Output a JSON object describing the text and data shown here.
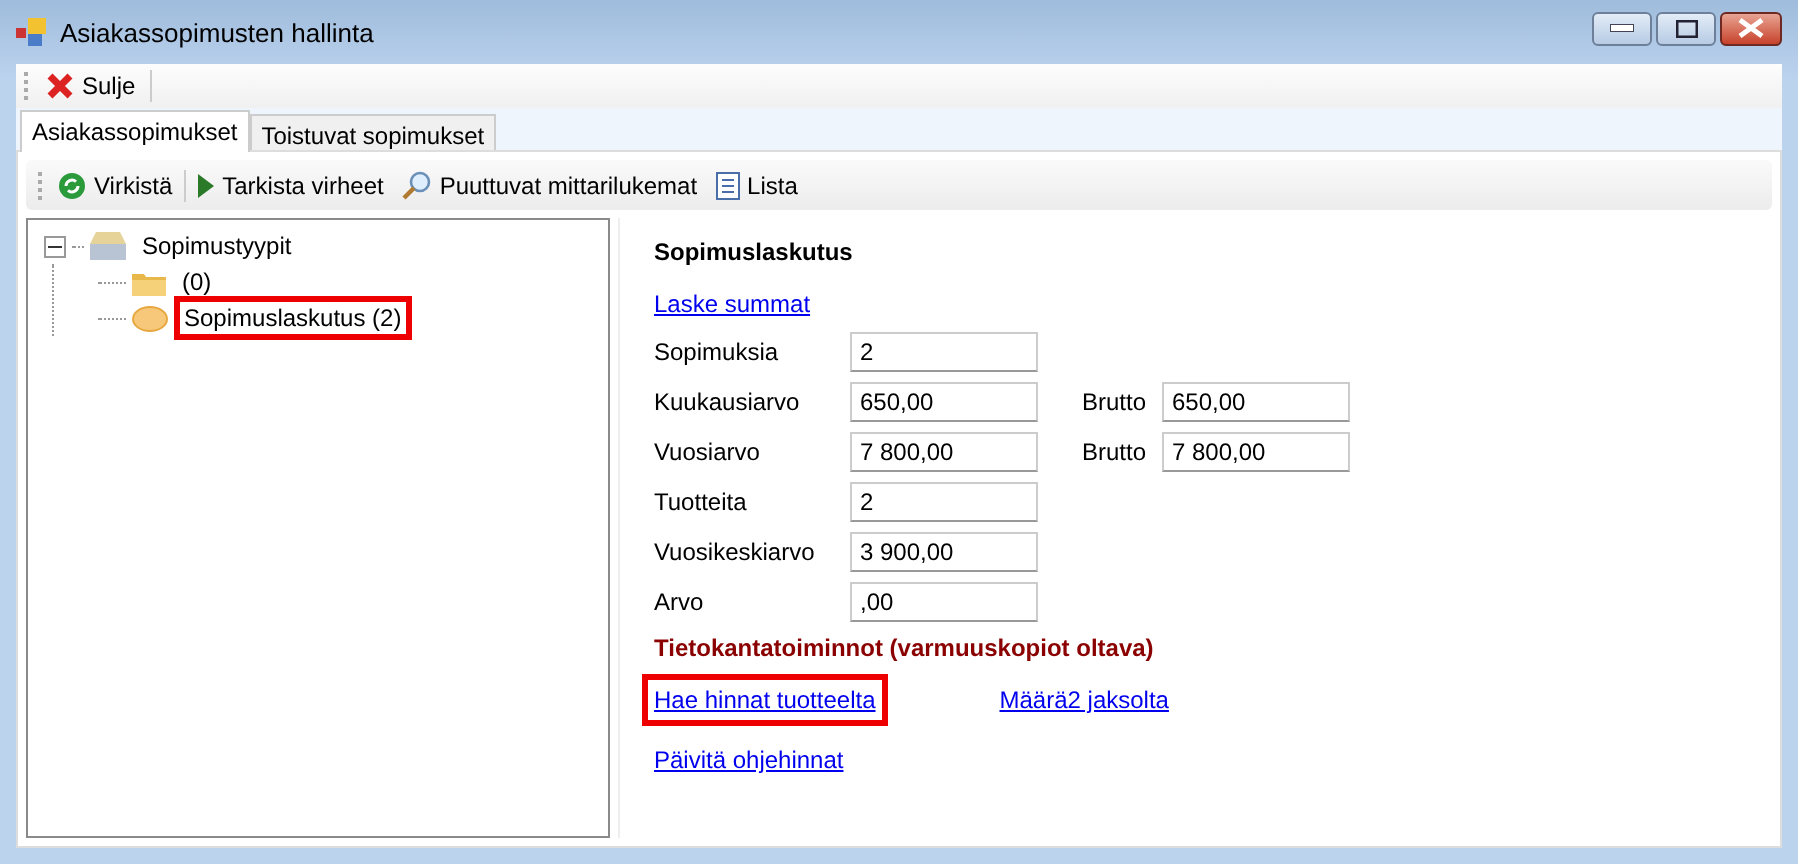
{
  "window": {
    "title": "Asiakassopimusten hallinta"
  },
  "toolbar": [
    {
      "label": "Sulje"
    }
  ],
  "tabs": [
    {
      "label": "Asiakassopimukset",
      "selected": true
    },
    {
      "label": "Toistuvat sopimukset",
      "selected": false
    }
  ],
  "inner_toolbar": [
    {
      "label": "Virkistä",
      "kind": "refresh"
    },
    {
      "label": "Tarkista virheet",
      "kind": "play"
    },
    {
      "label": "Puuttuvat mittarilukemat",
      "kind": "search"
    },
    {
      "label": "Lista",
      "kind": "list"
    }
  ],
  "tree": {
    "label": "Sopimustyypit",
    "expanded": true,
    "children": [
      {
        "label": "(0)",
        "kind": "folder",
        "highlighted": false
      },
      {
        "label": "Sopimuslaskutus (2)",
        "kind": "oval",
        "highlighted": true
      }
    ]
  },
  "details": {
    "title": "Sopimuslaskutus",
    "link": "Laske summat",
    "fields": [
      {
        "label": "Sopimuksia",
        "value": "2"
      },
      {
        "label": "Kuukausiarvo",
        "value": "650,00",
        "extra_label": "Brutto",
        "extra_value": "650,00"
      },
      {
        "label": "Vuosiarvo",
        "value": "7 800,00",
        "extra_label": "Brutto",
        "extra_value": "7 800,00"
      },
      {
        "label": "Tuotteita",
        "value": "2"
      },
      {
        "label": "Vuosikeskiarvo",
        "value": "3 900,00"
      },
      {
        "label": "Arvo",
        "value": ",00"
      }
    ],
    "db_title": "Tietokantatoiminnot (varmuuskopiot oltava)",
    "db_links": [
      [
        {
          "label": "Hae hinnat tuotteelta",
          "highlighted": true
        },
        {
          "label": "Määrä2 jaksolta",
          "highlighted": false
        }
      ],
      [
        {
          "label": "Päivitä ohjehinnat",
          "highlighted": false
        }
      ]
    ]
  }
}
